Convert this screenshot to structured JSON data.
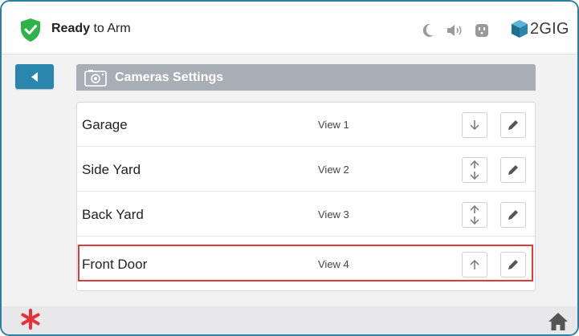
{
  "header": {
    "status_bold": "Ready",
    "status_rest": " to Arm",
    "brand": "2GIG",
    "icons": [
      "shield-check-icon",
      "moon-icon",
      "speaker-icon",
      "outlet-icon",
      "2gig-logo-icon"
    ]
  },
  "nav": {
    "back_icon": "back-arrow-icon"
  },
  "title_bar": {
    "icon": "camera-icon",
    "title": "Cameras Settings"
  },
  "cameras": [
    {
      "name": "Garage",
      "view": "View 1",
      "buttons": [
        "down"
      ]
    },
    {
      "name": "Side Yard",
      "view": "View 2",
      "buttons": [
        "up",
        "down"
      ]
    },
    {
      "name": "Back Yard",
      "view": "View 3",
      "buttons": [
        "up",
        "down"
      ]
    },
    {
      "name": "Front Door",
      "view": "View 4",
      "buttons": [
        "up"
      ]
    }
  ],
  "footer": {
    "left_icon": "asterisk-icon",
    "right_icon": "home-icon"
  },
  "colors": {
    "accent": "#2b86ad",
    "shield": "#2eb34a",
    "title_bar": "#a8aeb5",
    "highlight": "#e03a3a",
    "asterisk": "#e63238"
  }
}
